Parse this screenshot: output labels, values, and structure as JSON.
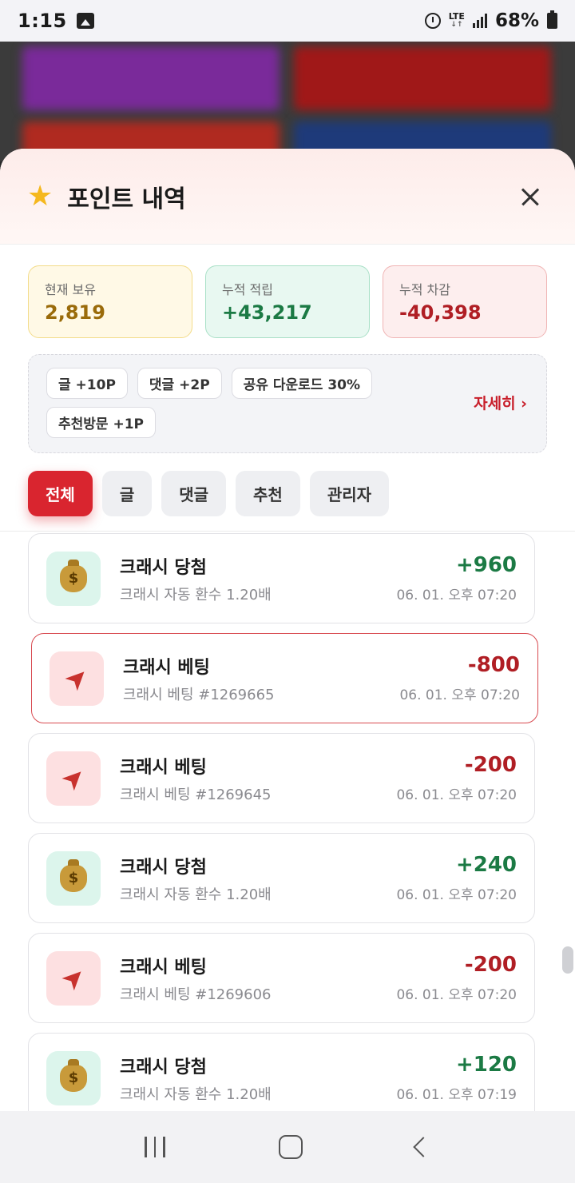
{
  "status_bar": {
    "time": "1:15",
    "network": "LTE",
    "battery": "68%"
  },
  "sheet": {
    "title": "포인트 내역",
    "icon": "star-icon",
    "close_icon": "close-icon"
  },
  "summary": {
    "current": {
      "label": "현재 보유",
      "value": "2,819"
    },
    "earned": {
      "label": "누적 적립",
      "value": "+43,217"
    },
    "spent": {
      "label": "누적 차감",
      "value": "-40,398"
    }
  },
  "rules": {
    "chips": [
      "글 +10P",
      "댓글 +2P",
      "공유 다운로드 30%",
      "추천방문 +1P"
    ],
    "detail_link": "자세히 ›"
  },
  "tabs": [
    {
      "label": "전체",
      "active": true
    },
    {
      "label": "글",
      "active": false
    },
    {
      "label": "댓글",
      "active": false
    },
    {
      "label": "추천",
      "active": false
    },
    {
      "label": "관리자",
      "active": false
    }
  ],
  "items": [
    {
      "title": "크래시 당첨",
      "sub": "크래시 자동 환수 1.20배",
      "amount": "+960",
      "date": "06. 01. 오후 07:20",
      "icon": "money-bag-icon"
    },
    {
      "title": "크래시 베팅",
      "sub": "크래시 베팅 #1269665",
      "amount": "-800",
      "date": "06. 01. 오후 07:20",
      "icon": "rocket-icon"
    },
    {
      "title": "크래시 베팅",
      "sub": "크래시 베팅 #1269645",
      "amount": "-200",
      "date": "06. 01. 오후 07:20",
      "icon": "rocket-icon"
    },
    {
      "title": "크래시 당첨",
      "sub": "크래시 자동 환수 1.20배",
      "amount": "+240",
      "date": "06. 01. 오후 07:20",
      "icon": "money-bag-icon"
    },
    {
      "title": "크래시 베팅",
      "sub": "크래시 베팅 #1269606",
      "amount": "-200",
      "date": "06. 01. 오후 07:20",
      "icon": "rocket-icon"
    },
    {
      "title": "크래시 당첨",
      "sub": "크래시 자동 환수 1.20배",
      "amount": "+120",
      "date": "06. 01. 오후 07:19",
      "icon": "money-bag-icon"
    }
  ],
  "colors": {
    "accent": "#d9252f",
    "positive": "#1b7a44",
    "negative": "#b01e24"
  }
}
